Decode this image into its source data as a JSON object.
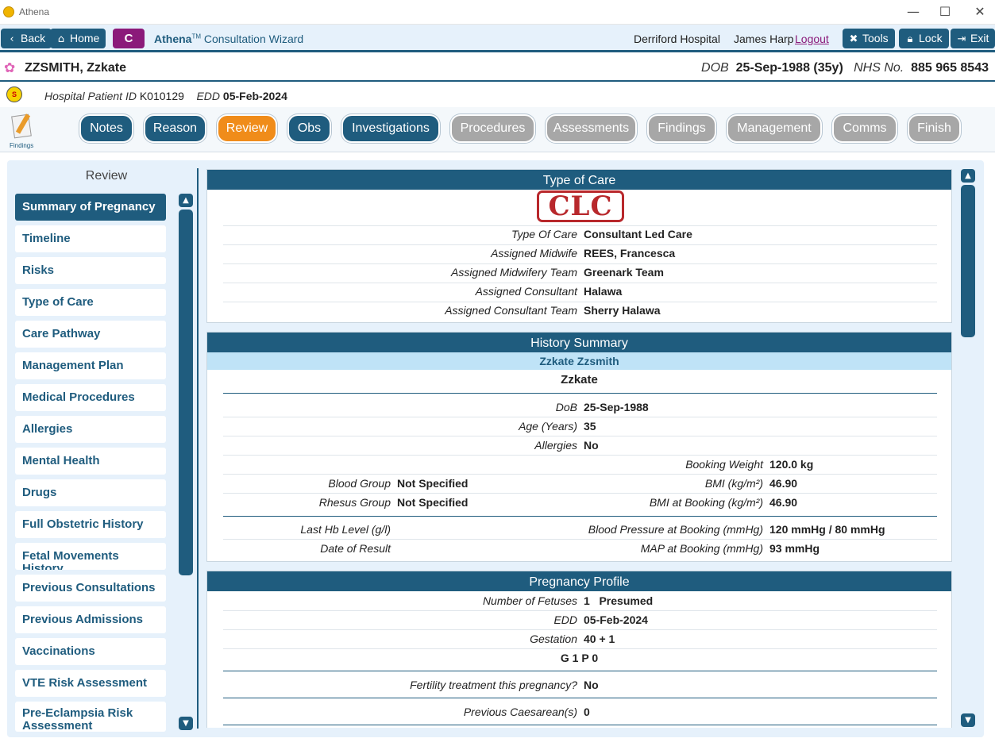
{
  "window": {
    "title": "Athena",
    "minimize": "—",
    "maximize": "☐",
    "close": "✕"
  },
  "toolbar": {
    "back": "Back",
    "home": "Home",
    "c_badge": "C",
    "app_name": "Athena",
    "app_tm": "TM",
    "app_subtitle": "Consultation Wizard",
    "hospital": "Derriford Hospital",
    "user": "James Harp",
    "logout": "Logout",
    "tools": "Tools",
    "lock": "Lock",
    "exit": "Exit"
  },
  "patient": {
    "name": "ZZSMITH, Zzkate",
    "dob_label": "DOB",
    "dob_value": "25-Sep-1988 (35y)",
    "nhs_label": "NHS No.",
    "nhs_value": "885 965 8543",
    "hospital_id_label": "Hospital Patient ID",
    "hospital_id": "K010129",
    "edd_label": "EDD",
    "edd": "05-Feb-2024"
  },
  "wizard": {
    "icon_label": "Findings",
    "steps": [
      {
        "label": "Notes",
        "state": "done"
      },
      {
        "label": "Reason",
        "state": "done"
      },
      {
        "label": "Review",
        "state": "active"
      },
      {
        "label": "Obs",
        "state": "done"
      },
      {
        "label": "Investigations",
        "state": "done"
      },
      {
        "label": "Procedures",
        "state": "todo"
      },
      {
        "label": "Assessments",
        "state": "todo"
      },
      {
        "label": "Findings",
        "state": "todo"
      },
      {
        "label": "Management",
        "state": "todo"
      },
      {
        "label": "Comms",
        "state": "todo"
      },
      {
        "label": "Finish",
        "state": "todo"
      }
    ]
  },
  "review_nav": {
    "title": "Review",
    "items": [
      "Summary of Pregnancy",
      "Timeline",
      "Risks",
      "Type of Care",
      "Care Pathway",
      "Management Plan",
      "Medical Procedures",
      "Allergies",
      "Mental Health",
      "Drugs",
      "Full Obstetric History",
      "Fetal Movements History",
      "Previous Consultations",
      "Previous Admissions",
      "Vaccinations",
      "VTE Risk Assessment",
      "Pre-Eclampsia Risk Assessment"
    ],
    "selected": "Summary of Pregnancy"
  },
  "type_of_care": {
    "title": "Type of Care",
    "stamp": "CLC",
    "rows": [
      {
        "label": "Type Of Care",
        "value": "Consultant Led Care"
      },
      {
        "label": "Assigned Midwife",
        "value": "REES, Francesca"
      },
      {
        "label": "Assigned Midwifery Team",
        "value": "Greenark Team"
      },
      {
        "label": "Assigned Consultant",
        "value": "Halawa"
      },
      {
        "label": "Assigned Consultant Team",
        "value": "Sherry Halawa"
      }
    ]
  },
  "history_summary": {
    "title": "History Summary",
    "full_name": "Zzkate Zzsmith",
    "first_name": "Zzkate",
    "dob_label": "DoB",
    "dob": "25-Sep-1988",
    "age_label": "Age (Years)",
    "age": "35",
    "allergies_label": "Allergies",
    "allergies": "No",
    "booking_weight_label": "Booking Weight",
    "booking_weight": "120.0 kg",
    "blood_group_label": "Blood Group",
    "blood_group": "Not Specified",
    "bmi_label": "BMI (kg/m²)",
    "bmi": "46.90",
    "rhesus_label": "Rhesus Group",
    "rhesus": "Not Specified",
    "bmi_booking_label": "BMI at Booking (kg/m²)",
    "bmi_booking": "46.90",
    "hb_label": "Last Hb Level (g/l)",
    "hb": "",
    "bp_label": "Blood Pressure at Booking (mmHg)",
    "bp": "120 mmHg / 80 mmHg",
    "result_date_label": "Date of Result",
    "result_date": "",
    "map_label": "MAP at Booking (mmHg)",
    "map": "93 mmHg"
  },
  "pregnancy_profile": {
    "title": "Pregnancy Profile",
    "fetuses_label": "Number of Fetuses",
    "fetuses": "1   Presumed",
    "edd_label": "EDD",
    "edd": "05-Feb-2024",
    "gestation_label": "Gestation",
    "gestation": "40 + 1",
    "gravida": "G 1 P 0",
    "fertility_label": "Fertility treatment this pregnancy?",
    "fertility": "No",
    "caesarean_label": "Previous Caesarean(s)",
    "caesarean": "0"
  }
}
